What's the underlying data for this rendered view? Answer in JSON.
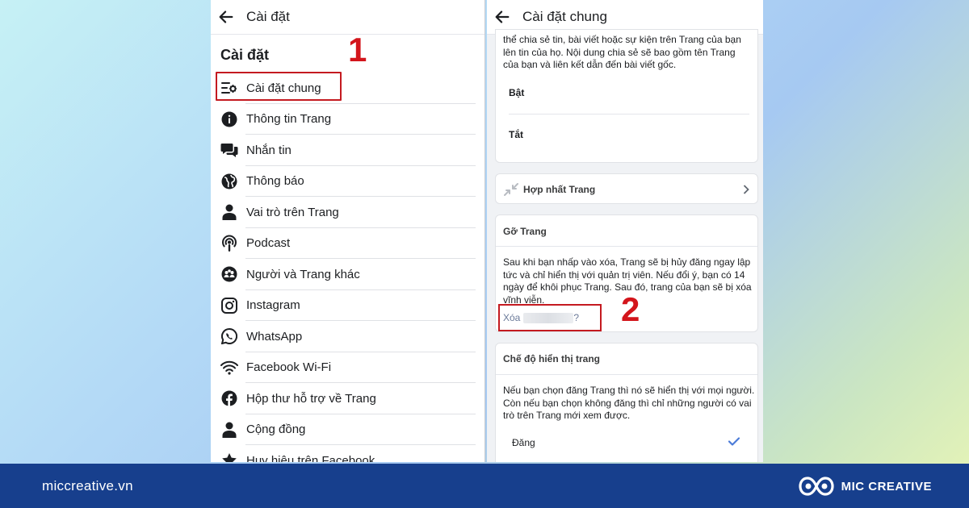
{
  "left_panel": {
    "header_title": "Cài đặt",
    "section_title": "Cài đặt",
    "step_number": "1",
    "items": [
      {
        "label": "Cài đặt chung",
        "icon": "settings-list-icon"
      },
      {
        "label": "Thông tin Trang",
        "icon": "info-icon"
      },
      {
        "label": "Nhắn tin",
        "icon": "chat-icon"
      },
      {
        "label": "Thông báo",
        "icon": "globe-icon"
      },
      {
        "label": "Vai trò trên Trang",
        "icon": "person-icon"
      },
      {
        "label": "Podcast",
        "icon": "podcast-icon"
      },
      {
        "label": "Người và Trang khác",
        "icon": "people-icon"
      },
      {
        "label": "Instagram",
        "icon": "instagram-icon"
      },
      {
        "label": "WhatsApp",
        "icon": "whatsapp-icon"
      },
      {
        "label": "Facebook Wi-Fi",
        "icon": "wifi-icon"
      },
      {
        "label": "Hộp thư hỗ trợ về Trang",
        "icon": "facebook-icon"
      },
      {
        "label": "Cộng đồng",
        "icon": "person-icon"
      },
      {
        "label": "Huy hiệu trên Facebook",
        "icon": "star-icon"
      }
    ]
  },
  "right_panel": {
    "header_title": "Cài đặt chung",
    "share_desc": "thể chia sẻ tin, bài viết hoặc sự kiện trên Trang của bạn lên tin của họ. Nội dung chia sẻ sẽ bao gồm tên Trang của bạn và liên kết dẫn đến bài viết gốc.",
    "option_on": "Bật",
    "option_off": "Tắt",
    "merge_label": "Hợp nhất Trang",
    "remove_title": "Gỡ Trang",
    "remove_desc": "Sau khi bạn nhấp vào xóa, Trang sẽ bị hủy đăng ngay lập tức và chỉ hiển thị với quản trị viên. Nếu đổi ý, bạn có 14 ngày để khôi phục Trang. Sau đó, trang của bạn sẽ bị xóa vĩnh viễn.",
    "delete_prefix": "Xóa",
    "delete_suffix": "?",
    "step_number": "2",
    "visibility_title": "Chế độ hiển thị trang",
    "visibility_desc": "Nếu bạn chọn đăng Trang thì nó sẽ hiển thị với mọi người. Còn nếu bạn chọn không đăng thì chỉ những người có vai trò trên Trang mới xem được.",
    "visibility_option": "Đăng"
  },
  "footer": {
    "url": "miccreative.vn",
    "brand": "MIC CREATIVE"
  },
  "colors": {
    "highlight": "#c41a20",
    "footer_bg": "#173f8d",
    "check": "#4b7bd8"
  }
}
